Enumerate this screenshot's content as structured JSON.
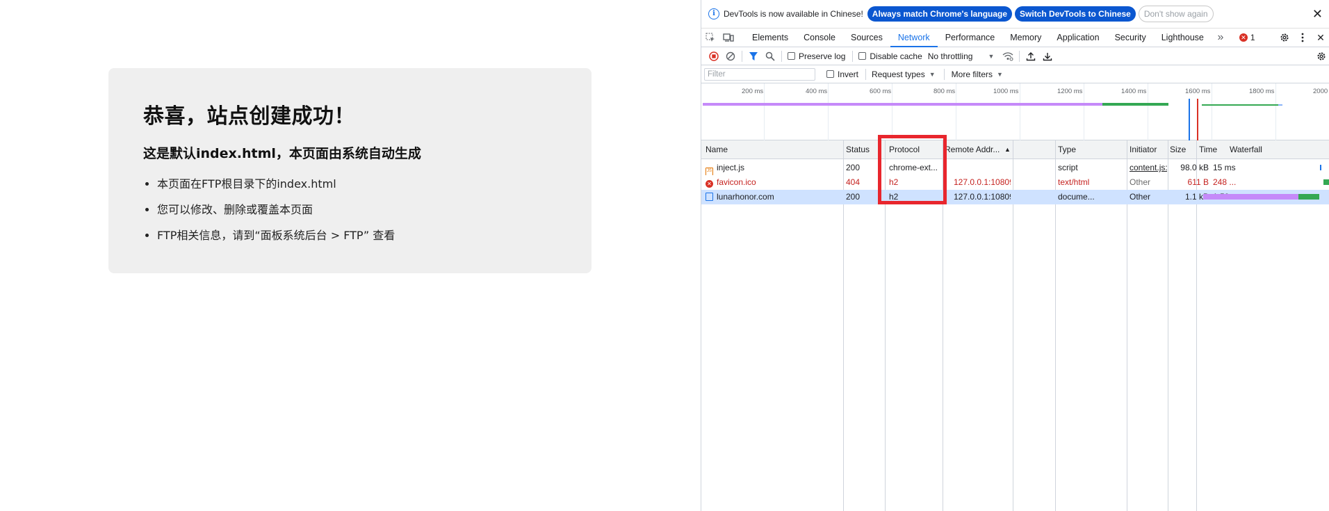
{
  "page": {
    "title": "恭喜，站点创建成功！",
    "subtitle": "这是默认index.html，本页面由系统自动生成",
    "bullets": [
      "本页面在FTP根目录下的index.html",
      "您可以修改、删除或覆盖本页面",
      "FTP相关信息，请到“面板系统后台 > FTP” 查看"
    ]
  },
  "infobar": {
    "message": "DevTools is now available in Chinese!",
    "match_label": "Always match Chrome's language",
    "switch_label": "Switch DevTools to Chinese",
    "dismiss_label": "Don't show again",
    "close_glyph": "✕"
  },
  "tabs": {
    "items": [
      "Elements",
      "Console",
      "Sources",
      "Network",
      "Performance",
      "Memory",
      "Application",
      "Security",
      "Lighthouse"
    ],
    "active": "Network",
    "more_glyph": "»",
    "error_count": "1"
  },
  "toolbar": {
    "preserve_log": "Preserve log",
    "disable_cache": "Disable cache",
    "throttling": "No throttling"
  },
  "filterbar": {
    "filter_placeholder": "Filter",
    "invert": "Invert",
    "request_types": "Request types",
    "more_filters": "More filters"
  },
  "overview": {
    "ticks": [
      "200 ms",
      "400 ms",
      "600 ms",
      "800 ms",
      "1000 ms",
      "1200 ms",
      "1400 ms",
      "1600 ms",
      "1800 ms",
      "2000"
    ]
  },
  "columns": {
    "name": "Name",
    "status": "Status",
    "protocol": "Protocol",
    "remote": "Remote Addr...",
    "type": "Type",
    "initiator": "Initiator",
    "size": "Size",
    "time": "Time",
    "waterfall": "Waterfall"
  },
  "requests": [
    {
      "name": "inject.js",
      "status": "200",
      "protocol": "chrome-ext...",
      "remote": "",
      "type": "script",
      "initiator": "content.js:1",
      "size": "98.0 kB",
      "time": "15 ms"
    },
    {
      "name": "favicon.ico",
      "status": "404",
      "protocol": "h2",
      "remote": "127.0.0.1:10809",
      "type": "text/html",
      "initiator": "Other",
      "size": "611 B",
      "time": "248 ..."
    },
    {
      "name": "lunarhonor.com",
      "status": "200",
      "protocol": "h2",
      "remote": "127.0.0.1:10809",
      "type": "docume...",
      "initiator": "Other",
      "size": "1.1 kB",
      "time": "1.50 s"
    }
  ],
  "colors": {
    "accent": "#1a73e8",
    "error": "#c5221f",
    "highlight_box": "#e8262d",
    "waterfall_waiting": "#c58af9",
    "waterfall_download": "#34a853"
  }
}
